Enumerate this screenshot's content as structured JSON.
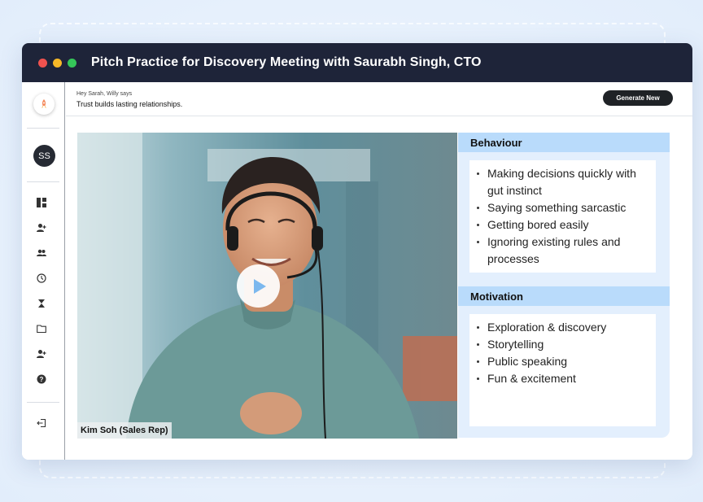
{
  "window": {
    "title": "Pitch Practice for Discovery Meeting with Saurabh Singh, CTO"
  },
  "sidebar": {
    "avatar_initials": "SS",
    "items": [
      {
        "icon": "dashboard-icon"
      },
      {
        "icon": "add-user-icon"
      },
      {
        "icon": "users-icon"
      },
      {
        "icon": "clock-icon"
      },
      {
        "icon": "hourglass-icon"
      },
      {
        "icon": "folder-icon"
      },
      {
        "icon": "user-plus-icon"
      },
      {
        "icon": "help-icon"
      },
      {
        "icon": "logout-icon"
      }
    ]
  },
  "header": {
    "greeting": "Hey Sarah, Willy says",
    "quote": "Trust builds lasting relationships.",
    "generate_label": "Generate New"
  },
  "video": {
    "caption": "Kim Soh (Sales Rep)"
  },
  "behaviour": {
    "heading": "Behaviour",
    "items": [
      "Making decisions quickly with gut instinct",
      "Saying something sarcastic",
      "Getting bored easily",
      "Ignoring existing rules and processes"
    ]
  },
  "motivation": {
    "heading": "Motivation",
    "items": [
      "Exploration & discovery",
      "Storytelling",
      "Public speaking",
      "Fun & excitement"
    ]
  },
  "colors": {
    "titlebar": "#1e2439",
    "section_header": "#b9dbfb",
    "panel_bg": "#e3effd",
    "button": "#1f2226"
  }
}
